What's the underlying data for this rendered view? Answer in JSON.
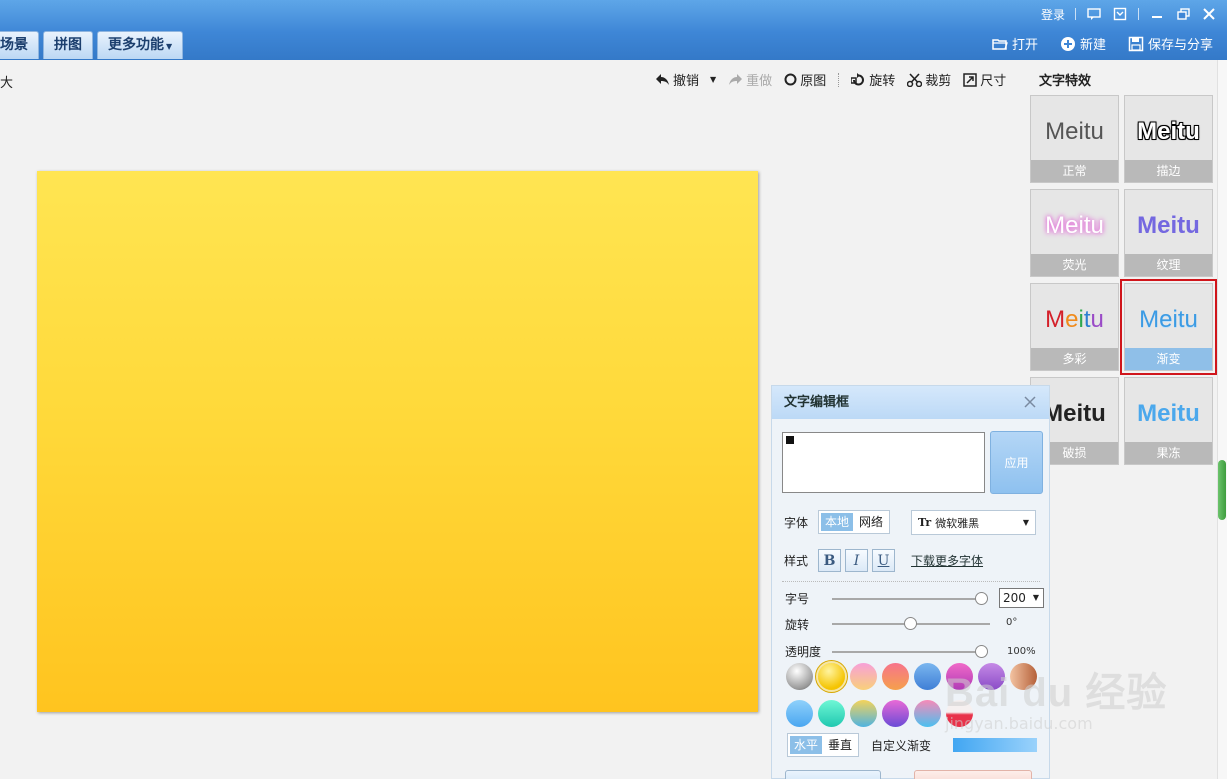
{
  "titlebar": {
    "login": "登录",
    "tabs": [
      "场景",
      "拼图",
      "更多功能"
    ],
    "actions": [
      {
        "label": "打开",
        "icon": "folder-icon"
      },
      {
        "label": "新建",
        "icon": "plus-circle-icon"
      },
      {
        "label": "保存与分享",
        "icon": "save-icon"
      }
    ]
  },
  "left_label": "大",
  "edit_tools": {
    "undo": "撤销",
    "redo": "重做",
    "original": "原图",
    "rotate": "旋转",
    "crop": "裁剪",
    "size": "尺寸"
  },
  "effects": {
    "title": "文字特效",
    "sample": "Meitu",
    "items": [
      "正常",
      "描边",
      "荧光",
      "纹理",
      "多彩",
      "渐变",
      "破损",
      "果冻"
    ],
    "selected": "渐变"
  },
  "editor": {
    "title": "文字编辑框",
    "text_value": "",
    "apply": "应用",
    "font_label": "字体",
    "font_local": "本地",
    "font_network": "网络",
    "font_name": "微软雅黑",
    "style_label": "样式",
    "bold": "B",
    "italic": "I",
    "underline": "U",
    "download_fonts": "下载更多字体",
    "size_label": "字号",
    "size_value": "200",
    "rotate_label": "旋转",
    "rotate_value": "0°",
    "opacity_label": "透明度",
    "opacity_value": "100%",
    "dir_horizontal": "水平",
    "dir_vertical": "垂直",
    "custom_gradient": "自定义渐变",
    "colors_row1": [
      "#9a9a9a",
      "#f5c400",
      "#f7a0b8",
      "#f08a4b",
      "#5b9be6",
      "#d64fc6",
      "#a46bd6",
      "#c97a4a"
    ],
    "colors_row2": [
      "#6ec0f7",
      "#3ee3c2",
      "#9acb5a",
      "#9a5bd6",
      "#f58ac0",
      "#e8324a"
    ]
  },
  "watermark": {
    "text": "Bai du 经验",
    "url": "jingyan.baidu.com"
  }
}
